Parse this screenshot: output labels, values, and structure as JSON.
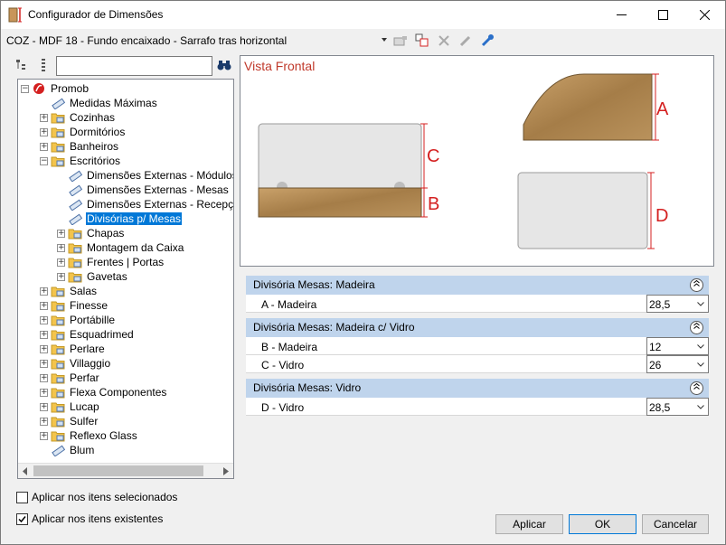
{
  "window": {
    "title": "Configurador de Dimensões",
    "minimize": "—",
    "maximize": "☐",
    "close": "✕"
  },
  "project_label": "COZ - MDF 18 - Fundo encaixado - Sarrafo tras horizontal",
  "tree": {
    "search_value": "",
    "items": [
      {
        "label": "Promob",
        "level": 0,
        "expander": "minus",
        "icon": "promob-icon"
      },
      {
        "label": "Medidas Máximas",
        "level": 1,
        "expander": "none",
        "icon": "tape-measure-icon"
      },
      {
        "label": "Cozinhas",
        "level": 1,
        "expander": "plus",
        "icon": "folder-icon"
      },
      {
        "label": "Dormitórios",
        "level": 1,
        "expander": "plus",
        "icon": "folder-icon"
      },
      {
        "label": "Banheiros",
        "level": 1,
        "expander": "plus",
        "icon": "folder-icon"
      },
      {
        "label": "Escritórios",
        "level": 1,
        "expander": "minus",
        "icon": "folder-icon"
      },
      {
        "label": "Dimensões Externas - Módulos",
        "level": 2,
        "expander": "none",
        "icon": "tape-measure-icon"
      },
      {
        "label": "Dimensões Externas - Mesas",
        "level": 2,
        "expander": "none",
        "icon": "tape-measure-icon"
      },
      {
        "label": "Dimensões Externas - Recepção",
        "level": 2,
        "expander": "none",
        "icon": "tape-measure-icon"
      },
      {
        "label": "Divisórias p/ Mesas",
        "level": 2,
        "expander": "none",
        "icon": "tape-measure-icon",
        "selected": true
      },
      {
        "label": "Chapas",
        "level": 2,
        "expander": "plus",
        "icon": "folder-icon"
      },
      {
        "label": "Montagem da Caixa",
        "level": 2,
        "expander": "plus",
        "icon": "folder-icon"
      },
      {
        "label": "Frentes | Portas",
        "level": 2,
        "expander": "plus",
        "icon": "folder-icon"
      },
      {
        "label": "Gavetas",
        "level": 2,
        "expander": "plus",
        "icon": "folder-icon"
      },
      {
        "label": "Salas",
        "level": 1,
        "expander": "plus",
        "icon": "folder-icon"
      },
      {
        "label": "Finesse",
        "level": 1,
        "expander": "plus",
        "icon": "folder-icon"
      },
      {
        "label": "Portábille",
        "level": 1,
        "expander": "plus",
        "icon": "folder-icon"
      },
      {
        "label": "Esquadrimed",
        "level": 1,
        "expander": "plus",
        "icon": "folder-icon"
      },
      {
        "label": "Perlare",
        "level": 1,
        "expander": "plus",
        "icon": "folder-icon"
      },
      {
        "label": "Villaggio",
        "level": 1,
        "expander": "plus",
        "icon": "folder-icon"
      },
      {
        "label": "Perfar",
        "level": 1,
        "expander": "plus",
        "icon": "folder-icon"
      },
      {
        "label": "Flexa Componentes",
        "level": 1,
        "expander": "plus",
        "icon": "folder-icon"
      },
      {
        "label": "Lucap",
        "level": 1,
        "expander": "plus",
        "icon": "folder-icon"
      },
      {
        "label": "Sulfer",
        "level": 1,
        "expander": "plus",
        "icon": "folder-icon"
      },
      {
        "label": "Reflexo Glass",
        "level": 1,
        "expander": "plus",
        "icon": "folder-icon"
      },
      {
        "label": "Blum",
        "level": 1,
        "expander": "none",
        "icon": "tape-measure-icon"
      }
    ]
  },
  "preview": {
    "title": "Vista Frontal",
    "labels": {
      "a": "A",
      "b": "B",
      "c": "C",
      "d": "D"
    },
    "accent_color": "#d42020",
    "wood_color": "#b08a55"
  },
  "groups": [
    {
      "title": "Divisória Mesas: Madeira",
      "rows": [
        {
          "name": "A - Madeira",
          "value": "28,5"
        }
      ]
    },
    {
      "title": "Divisória Mesas: Madeira c/ Vidro",
      "rows": [
        {
          "name": "B - Madeira",
          "value": "12"
        },
        {
          "name": "C - Vidro",
          "value": "26"
        }
      ]
    },
    {
      "title": "Divisória Mesas: Vidro",
      "rows": [
        {
          "name": "D - Vidro",
          "value": "28,5"
        }
      ]
    }
  ],
  "options": {
    "apply_selected": {
      "label": "Aplicar nos itens selecionados",
      "checked": false
    },
    "apply_existing": {
      "label": "Aplicar nos itens existentes",
      "checked": true
    }
  },
  "buttons": {
    "apply": "Aplicar",
    "ok": "OK",
    "cancel": "Cancelar"
  }
}
